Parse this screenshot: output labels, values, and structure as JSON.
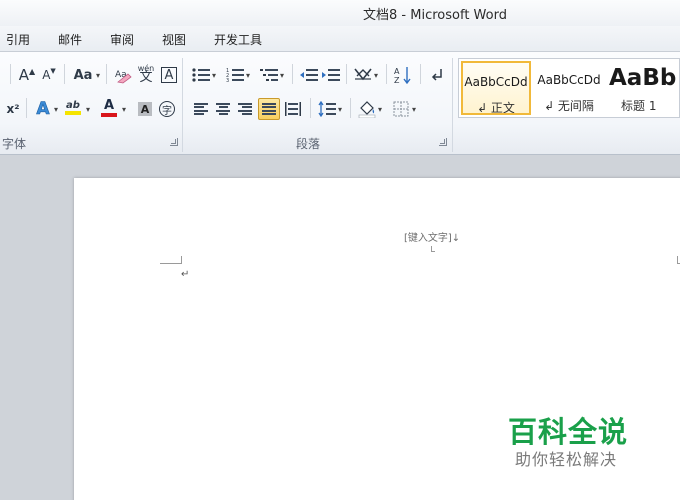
{
  "window": {
    "title": "文档8  -  Microsoft Word"
  },
  "tabs": [
    {
      "label": "引用"
    },
    {
      "label": "邮件"
    },
    {
      "label": "审阅"
    },
    {
      "label": "视图"
    },
    {
      "label": "开发工具"
    }
  ],
  "ribbon": {
    "groups": {
      "font": {
        "label": "字体"
      },
      "paragraph": {
        "label": "段落"
      }
    },
    "font_buttons": {
      "grow": "A",
      "shrink": "A",
      "change_case": "Aa",
      "pinyin": "wén",
      "pinyin_char": "文",
      "border_char": "A",
      "superscript": "x²",
      "text_effect": "A",
      "highlight": "ab",
      "font_color": "A",
      "char_shading": "A",
      "enclose": "字"
    },
    "styles": [
      {
        "sample": "AaBbCcDd",
        "name": "↲ 正文",
        "selected": true
      },
      {
        "sample": "AaBbCcDd",
        "name": "↲ 无间隔",
        "selected": false
      },
      {
        "sample": "AaBb",
        "name": "标题 1",
        "selected": false
      }
    ]
  },
  "document": {
    "header_placeholder": "[键入文字]↓",
    "paragraph_mark": "↵"
  },
  "watermark": {
    "title": "百科全说",
    "subtitle": "助你轻松解决"
  },
  "colors": {
    "highlight": "#f5e400",
    "font_color": "#d9151b",
    "text_effect": "#3a8ad6",
    "selected_style_border": "#f1b93a",
    "watermark_green": "#1aa04a"
  }
}
